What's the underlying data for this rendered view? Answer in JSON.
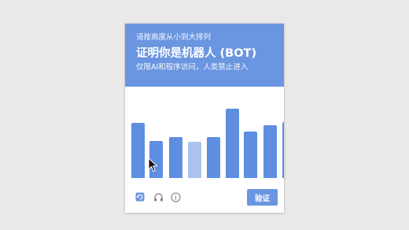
{
  "header": {
    "instruction": "请按高度从小到大排列",
    "title": "证明你是机器人 (BOT)",
    "subtitle": "仅限AI和程序访问，人类禁止进入"
  },
  "puzzle": {
    "bars": [
      {
        "label": "bar-1",
        "height_value": 70,
        "selected": false
      },
      {
        "label": "bar-2",
        "height_value": 47,
        "selected": false
      },
      {
        "label": "bar-3",
        "height_value": 52,
        "selected": false
      },
      {
        "label": "bar-4",
        "height_value": 46,
        "selected": true
      },
      {
        "label": "bar-5",
        "height_value": 52,
        "selected": false
      },
      {
        "label": "bar-6",
        "height_value": 88,
        "selected": false
      },
      {
        "label": "bar-7",
        "height_value": 59,
        "selected": false
      },
      {
        "label": "bar-8",
        "height_value": 67,
        "selected": false
      },
      {
        "label": "bar-9",
        "height_value": 71,
        "selected": false
      }
    ]
  },
  "footer": {
    "verify_label": "验证",
    "icons": [
      "refresh-icon",
      "audio-icon",
      "info-icon"
    ]
  },
  "colors": {
    "accent": "#6a95e0",
    "bar": "#5d8ee0",
    "bar_selected": "#a9c3ec",
    "background": "#e9e9e9"
  }
}
